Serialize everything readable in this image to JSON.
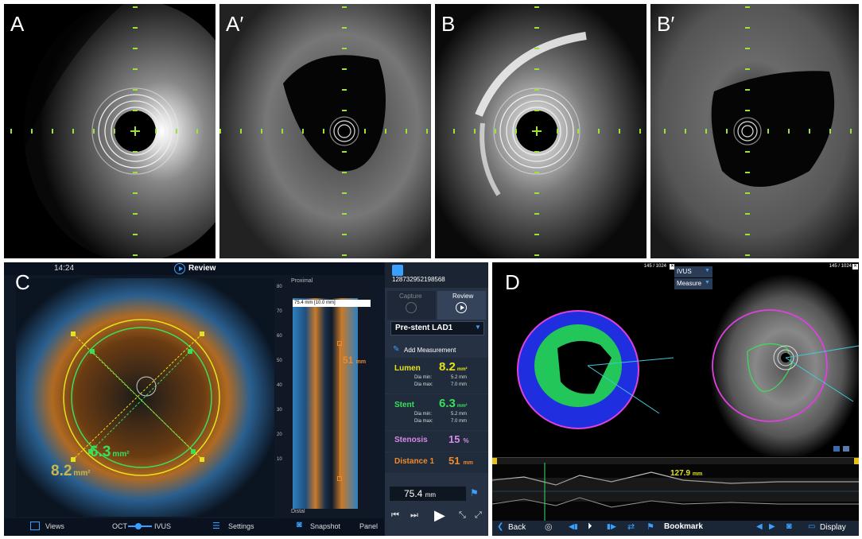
{
  "panels": {
    "a": "A",
    "a_prime": "A′",
    "b": "B",
    "b_prime": "B′",
    "c": "C",
    "d": "D"
  },
  "colors": {
    "crosshair": "#9be23a",
    "oct_orange": "#e08a2a",
    "oct_blue": "#2f7fbf",
    "lumen_yellow": "#e5e21a",
    "stent_green": "#38e05a",
    "stenosis_pink": "#d88ae6",
    "distance_orange": "#f08a2a",
    "vessel_magenta": "#e040e0"
  },
  "oct_review": {
    "header": {
      "time": "14:24",
      "mode_label": "Review"
    },
    "image_labels": {
      "stent_value": "6.3",
      "stent_unit": "mm²",
      "lumen_value": "8.2",
      "lumen_unit": "mm²"
    },
    "longitudinal": {
      "top_label": "Proximal",
      "bottom_label": "Distal",
      "scale_ticks": [
        "80",
        "70",
        "60",
        "50",
        "40",
        "30",
        "20",
        "10"
      ],
      "range_label": "75.4 mm [10.0 mm]",
      "segment_label": "51",
      "segment_unit": "mm"
    },
    "bottom_bar": {
      "views": "Views",
      "oct": "OCT",
      "ivus": "IVUS",
      "settings": "Settings",
      "snapshot": "Snapshot",
      "panel": "Panel"
    },
    "side_panel": {
      "patient_id": "128732952198568",
      "tab_capture": "Capture",
      "tab_review": "Review",
      "run_select": "Pre-stent LAD1",
      "add_measurement": "Add Measurement",
      "lumen": {
        "label": "Lumen",
        "value": "8.2",
        "unit": "mm²",
        "dia_min_label": "Dia min:",
        "dia_min": "5.2 mm",
        "dia_max_label": "Dia max:",
        "dia_max": "7.0 mm"
      },
      "stent": {
        "label": "Stent",
        "value": "6.3",
        "unit": "mm²",
        "dia_min_label": "Dia min:",
        "dia_min": "5.2 mm",
        "dia_max_label": "Dia max:",
        "dia_max": "7.0 mm"
      },
      "stenosis": {
        "label": "Stenosis",
        "value": "15",
        "unit": "%"
      },
      "distance": {
        "label": "Distance 1",
        "value": "51",
        "unit": "mm"
      },
      "position": {
        "value": "75.4",
        "unit": "mm"
      }
    }
  },
  "ivus_review": {
    "frame_left": "145 / 1024",
    "frame_right": "145 / 1024",
    "mode_select": "IVUS",
    "measure_select": "Measure",
    "long_label": "127.9",
    "long_unit": "mm",
    "bottom_bar": {
      "back": "Back",
      "bookmark": "Bookmark",
      "display": "Display"
    }
  }
}
